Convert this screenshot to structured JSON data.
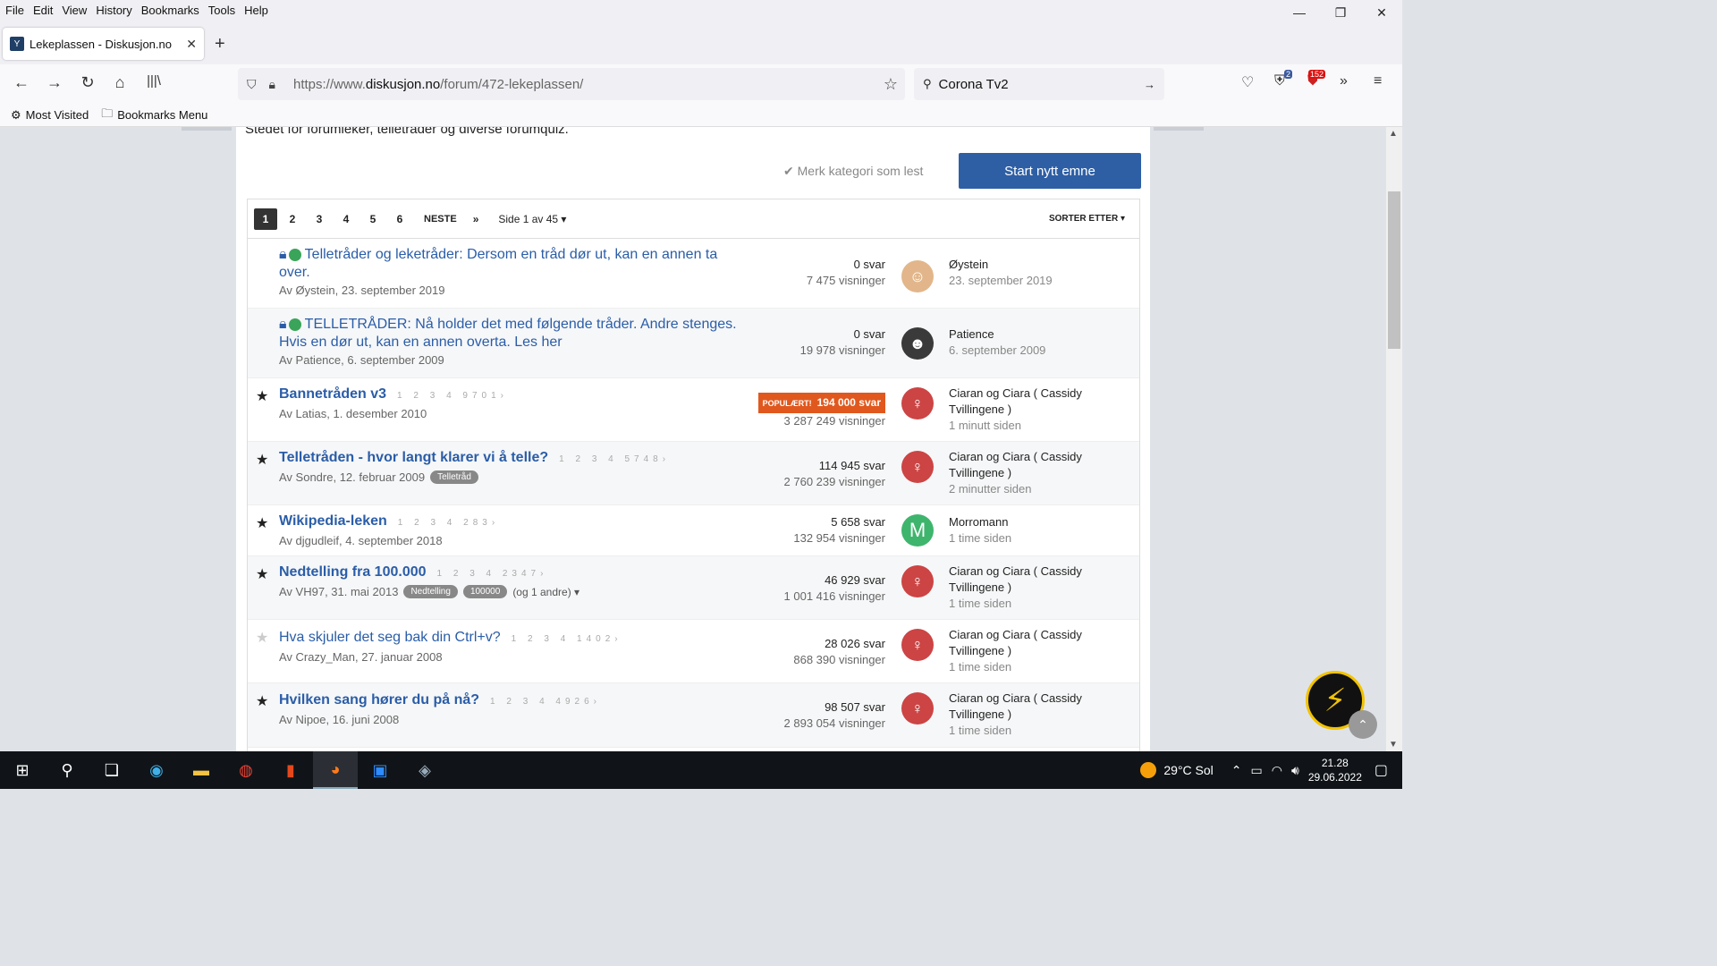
{
  "menu": [
    "File",
    "Edit",
    "View",
    "History",
    "Bookmarks",
    "Tools",
    "Help"
  ],
  "tab": {
    "title": "Lekeplassen - Diskusjon.no"
  },
  "url": {
    "prefix": "https://www.",
    "domain": "diskusjon.no",
    "path": "/forum/472-lekeplassen/"
  },
  "search": {
    "query": "Corona Tv2"
  },
  "toolbar_badges": {
    "ext1": "2",
    "ext2": "152"
  },
  "bookmarks": [
    "Most Visited",
    "Bookmarks Menu"
  ],
  "page": {
    "description": "Stedet for forumleker, telletråder og diverse forumquiz.",
    "mark_read": "Merk kategori som lest",
    "start_topic": "Start nytt emne",
    "pager": {
      "pages": [
        "1",
        "2",
        "3",
        "4",
        "5",
        "6"
      ],
      "next": "NESTE",
      "last": "»",
      "page_of": "Side 1 av 45",
      "sort": "SORTER ETTER"
    }
  },
  "topics": [
    {
      "title": "Telletråder og leketråder: Dersom en tråd dør ut, kan en annen ta over.",
      "meta": "Av Øystein, 23. september 2019",
      "replies": "0 svar",
      "views": "7 475 visninger",
      "last_user": "Øystein",
      "last_time": "23. september 2019"
    },
    {
      "title": "TELLETRÅDER: Nå holder det med følgende tråder. Andre stenges. Hvis en dør ut, kan en annen overta. Les her",
      "meta": "Av Patience, 6. september 2009",
      "replies": "0 svar",
      "views": "19 978 visninger",
      "last_user": "Patience",
      "last_time": "6. september 2009"
    },
    {
      "title": "Bannetråden v3",
      "mini": "1 2 3 4 9701›",
      "meta": "Av Latias, 1. desember 2010",
      "popular": "POPULÆRT!",
      "replies": "194 000 svar",
      "views": "3 287 249 visninger",
      "last_user": "Ciaran og Ciara ( Cassidy Tvillingene )",
      "last_time": "1 minutt siden"
    },
    {
      "title": "Telletråden - hvor langt klarer vi å telle?",
      "mini": "1 2 3 4 5748›",
      "meta": "Av Sondre, 12. februar 2009",
      "tags": [
        "Telletråd"
      ],
      "replies": "114 945 svar",
      "views": "2 760 239 visninger",
      "last_user": "Ciaran og Ciara ( Cassidy Tvillingene )",
      "last_time": "2 minutter siden"
    },
    {
      "title": "Wikipedia-leken",
      "mini": "1 2 3 4 283›",
      "meta": "Av djgudleif, 4. september 2018",
      "replies": "5 658 svar",
      "views": "132 954 visninger",
      "last_user": "Morromann",
      "last_time": "1 time siden",
      "avatar_letter": "M"
    },
    {
      "title": "Nedtelling fra 100.000",
      "mini": "1 2 3 4 2347›",
      "meta": "Av VH97, 31. mai 2013",
      "tags": [
        "Nedtelling",
        "100000"
      ],
      "tags_more": "(og 1 andre) ▾",
      "replies": "46 929 svar",
      "views": "1 001 416 visninger",
      "last_user": "Ciaran og Ciara ( Cassidy Tvillingene )",
      "last_time": "1 time siden"
    },
    {
      "title": "Hva skjuler det seg bak din Ctrl+v?",
      "mini": "1 2 3 4 1402›",
      "meta": "Av Crazy_Man, 27. januar 2008",
      "replies": "28 026 svar",
      "views": "868 390 visninger",
      "last_user": "Ciaran og Ciara ( Cassidy Tvillingene )",
      "last_time": "1 time siden"
    },
    {
      "title": "Hvilken sang hører du på nå?",
      "mini": "1 2 3 4 4926›",
      "meta": "Av Nipoe, 16. juni 2008",
      "replies": "98 507 svar",
      "views": "2 893 054 visninger",
      "last_user": "Ciaran og Ciara ( Cassidy Tvillingene )",
      "last_time": "1 time siden"
    }
  ],
  "taskbar": {
    "weather": "29°C  Sol",
    "time": "21.28",
    "date": "29.06.2022"
  }
}
